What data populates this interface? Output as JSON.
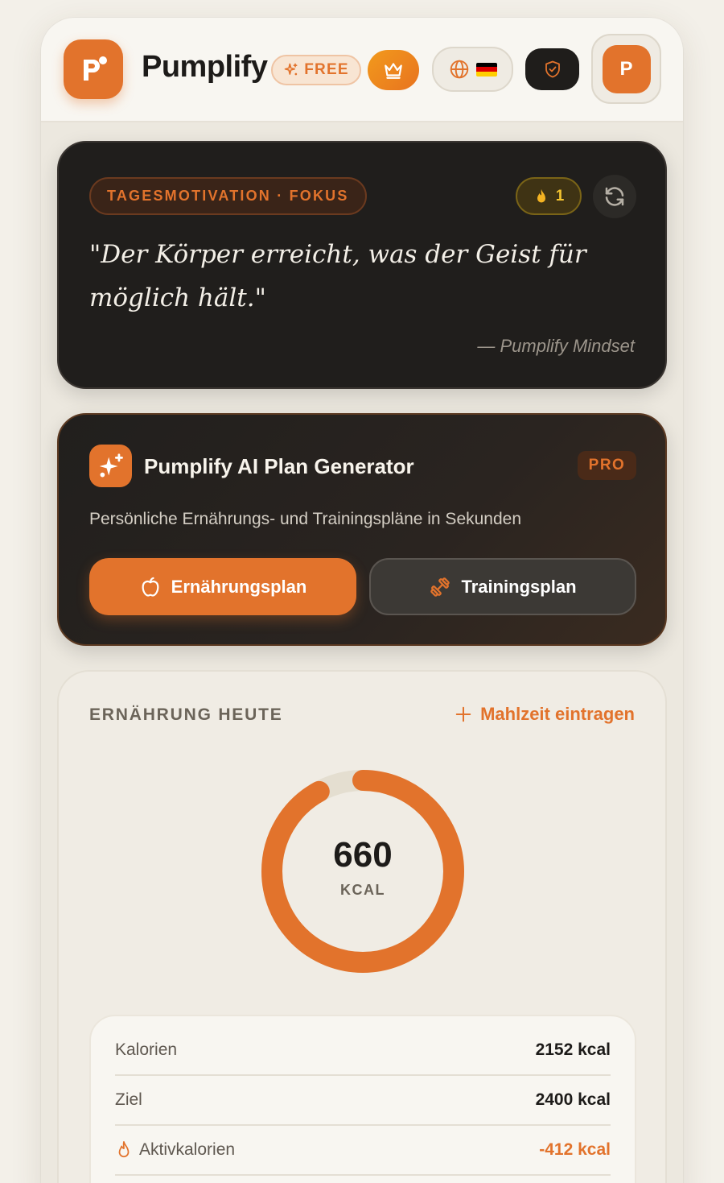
{
  "app": {
    "name": "Pumplify",
    "plan_badge": "FREE",
    "language_flag": "de",
    "avatar_initial": "P"
  },
  "motivation": {
    "tag": "TAGESMOTIVATION · FOKUS",
    "streak_count": "1",
    "quote": "\"Der Körper erreicht, was der Geist für möglich hält.\"",
    "author": "— Pumplify Mindset"
  },
  "ai_generator": {
    "title": "Pumplify AI Plan Generator",
    "badge": "PRO",
    "subtitle": "Persönliche Ernährungs- und Trainingspläne in Sekunden",
    "nutrition_button": "Ernährungsplan",
    "training_button": "Trainingsplan"
  },
  "nutrition": {
    "title": "ERNÄHRUNG HEUTE",
    "add_meal": "Mahlzeit eintragen",
    "ring_value": "660",
    "ring_unit": "KCAL",
    "ring_progress": 0.92,
    "rows": [
      {
        "label": "Kalorien",
        "value": "2152 kcal"
      },
      {
        "label": "Ziel",
        "value": "2400 kcal"
      },
      {
        "label": "Aktivkalorien",
        "value": "-412 kcal"
      }
    ]
  },
  "colors": {
    "accent": "#e2732c",
    "dark_card": "#201e1c",
    "background": "#f3f0e9"
  }
}
